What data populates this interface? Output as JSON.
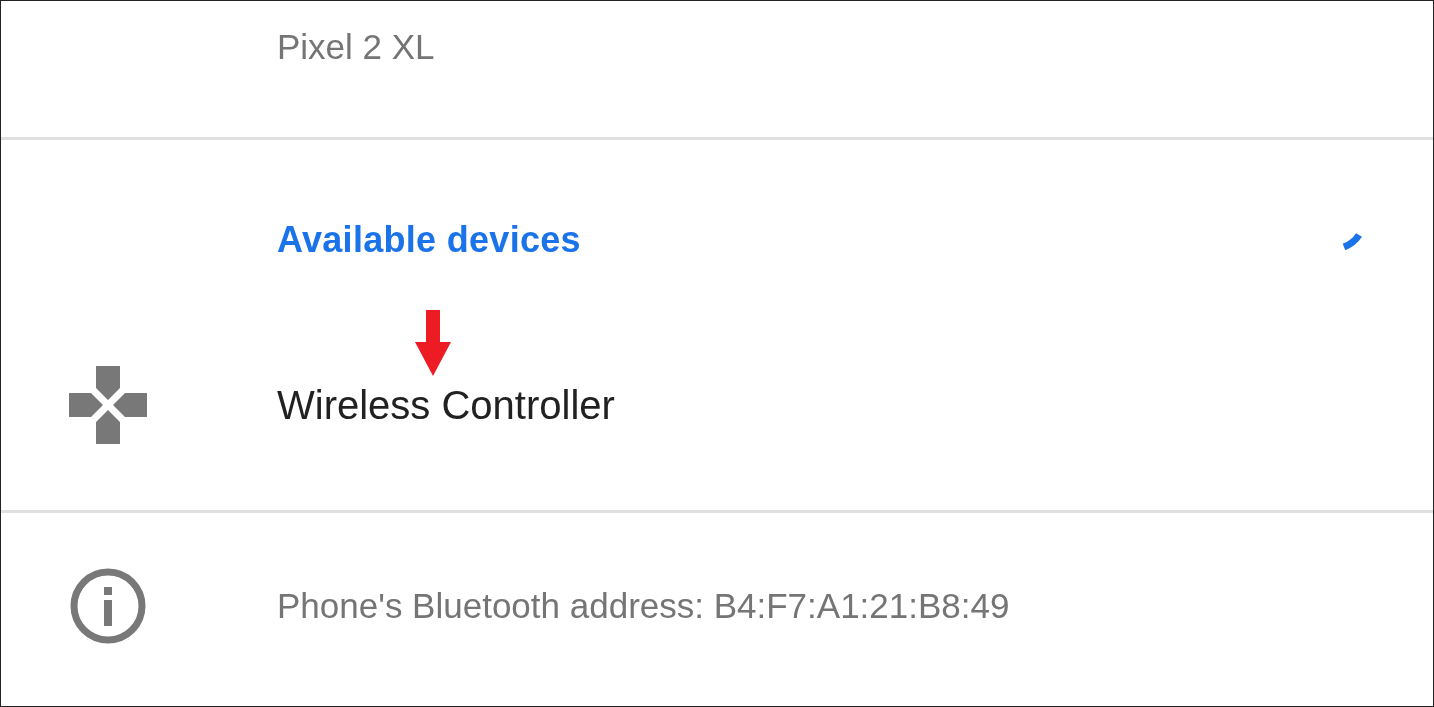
{
  "device_name": {
    "value": "Pixel 2 XL"
  },
  "available_devices": {
    "title": "Available devices",
    "scanning": true,
    "devices": [
      {
        "name": "Wireless Controller",
        "kind": "gamepad",
        "highlighted": true
      }
    ]
  },
  "footer": {
    "text": "Phone's Bluetooth address: B4:F7:A1:21:B8:49"
  }
}
